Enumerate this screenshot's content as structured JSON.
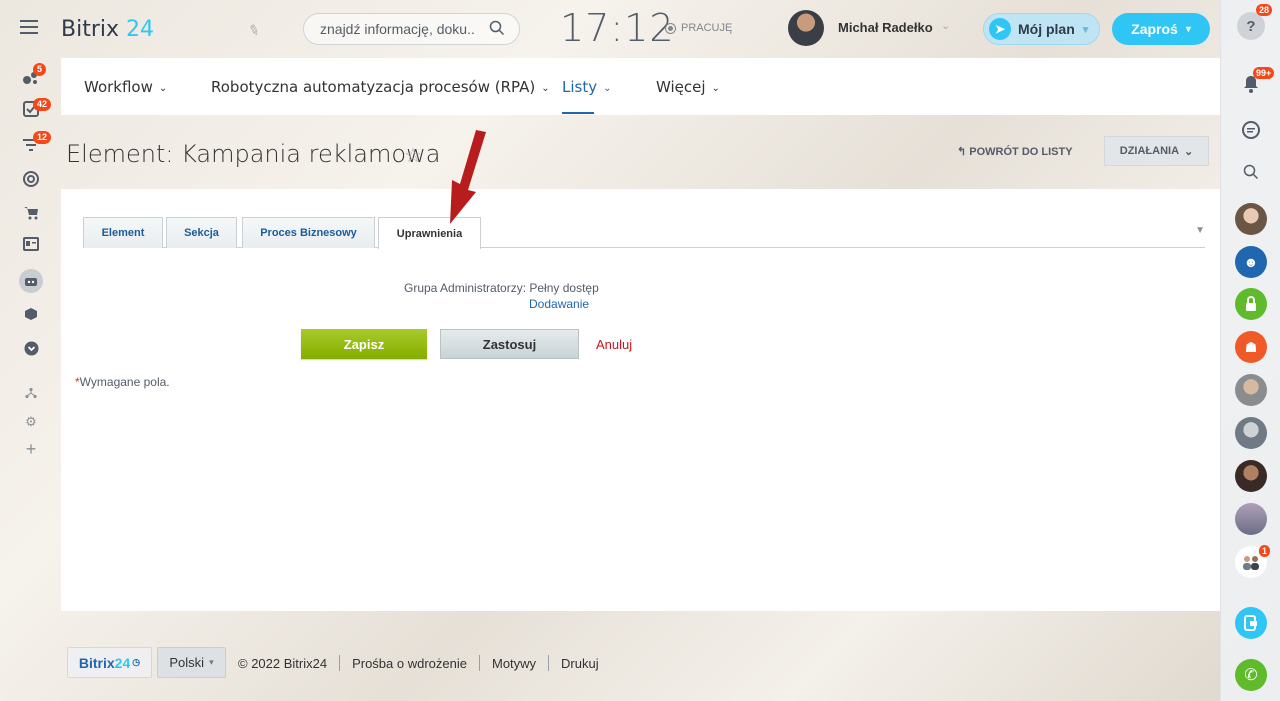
{
  "header": {
    "logo_word": "Bitrix",
    "logo_num": "24",
    "search_placeholder": "znajdź informację, doku...",
    "clock": "17:12",
    "work_status": "PRACUJĘ",
    "user_name": "Michał Radełko",
    "plan_label": "Mój plan",
    "invite_label": "Zaproś"
  },
  "left_sidebar": {
    "badges": [
      "5",
      "42",
      "12"
    ]
  },
  "right_sidebar": {
    "help_badge": "28",
    "notifications_badge": "99+",
    "chat_badge": "1"
  },
  "navbar": {
    "items": [
      {
        "label": "Workflow"
      },
      {
        "label": "Robotyczna automatyzacja procesów (RPA)"
      },
      {
        "label": "Listy"
      },
      {
        "label": "Więcej"
      }
    ],
    "active": "Listy"
  },
  "page": {
    "title": "Element: Kampania reklamowa",
    "back_link": "POWRÓT DO LISTY",
    "actions_label": "DZIAŁANIA"
  },
  "tabs": [
    {
      "label": "Element"
    },
    {
      "label": "Sekcja"
    },
    {
      "label": "Proces Biznesowy"
    },
    {
      "label": "Uprawnienia"
    }
  ],
  "active_tab": "Uprawnienia",
  "permissions": {
    "group_text": "Grupa Administratorzy: Pełny dostęp",
    "add_link": "Dodawanie"
  },
  "form": {
    "save_label": "Zapisz",
    "apply_label": "Zastosuj",
    "cancel_label": "Anuluj",
    "required_asterisk": "*",
    "required_text": "Wymagane pola."
  },
  "footer": {
    "logo_word": "Bitrix",
    "logo_num": "24",
    "language": "Polski",
    "copyright": "© 2022 Bitrix24",
    "links": [
      "Prośba o wdrożenie",
      "Motywy",
      "Drukuj"
    ]
  },
  "colors": {
    "accent": "#2fc6f6",
    "link": "#2067b0",
    "save_green": "#94bd0d",
    "cancel_red": "#c9151e",
    "badge_red": "#f54819",
    "annotation_arrow": "#b81d1d"
  }
}
